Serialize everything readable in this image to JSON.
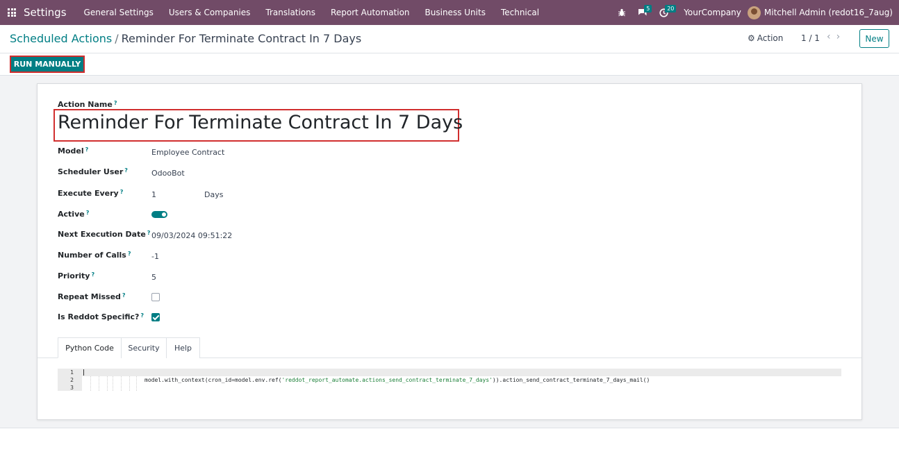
{
  "navbar": {
    "app_title": "Settings",
    "menu": [
      "General Settings",
      "Users & Companies",
      "Translations",
      "Report Automation",
      "Business Units",
      "Technical"
    ],
    "messages_count": "5",
    "activities_count": "20",
    "company": "YourCompany",
    "user": "Mitchell Admin (redot16_7aug)"
  },
  "control_panel": {
    "breadcrumb_parent": "Scheduled Actions",
    "breadcrumb_separator": "/",
    "breadcrumb_current": "Reminder For Terminate Contract In 7 Days",
    "action_label": "Action",
    "pager": "1 / 1",
    "new_label": "New"
  },
  "statusbar": {
    "run_label": "RUN MANUALLY"
  },
  "form": {
    "name_label": "Action Name",
    "tooltip_mark": "?",
    "name_value": "Reminder For Terminate Contract In 7 Days",
    "model_label": "Model",
    "model_value": "Employee Contract",
    "user_label": "Scheduler User",
    "user_value": "OdooBot",
    "interval_label": "Execute Every",
    "interval_number": "1",
    "interval_type": "Days",
    "active_label": "Active",
    "active": true,
    "nextcall_label": "Next Execution Date",
    "nextcall_value": "09/03/2024 09:51:22",
    "numcall_label": "Number of Calls",
    "numcall_value": "-1",
    "priority_label": "Priority",
    "priority_value": "5",
    "doall_label": "Repeat Missed",
    "doall": false,
    "reddot_label": "Is Reddot Specific?",
    "reddot": true
  },
  "tabs": [
    "Python Code",
    "Security",
    "Help"
  ],
  "code": {
    "line_numbers": [
      "1",
      "2",
      "3"
    ],
    "prefix": "model.with_context(cron_id=model.env.ref(",
    "string": "'reddot_report_automate.actions_send_contract_terminate_7_days'",
    "suffix": ")).action_send_contract_terminate_7_days_mail()"
  },
  "colors": {
    "navbar": "#714b67",
    "primary": "#017e84",
    "highlight_border": "#d12e2e"
  }
}
